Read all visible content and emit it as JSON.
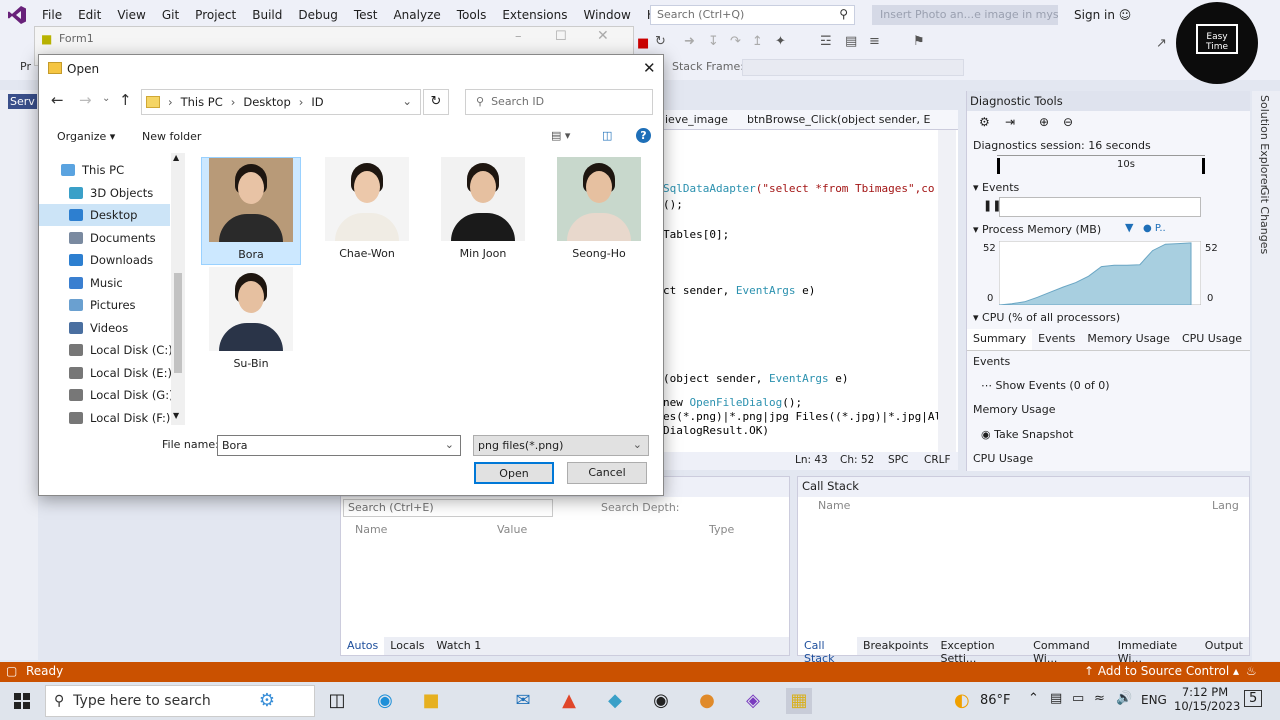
{
  "vs": {
    "menu": [
      "File",
      "Edit",
      "View",
      "Git",
      "Project",
      "Build",
      "Debug",
      "Test",
      "Analyze",
      "Tools",
      "Extensions",
      "Window",
      "Help"
    ],
    "search_placeholder": "Search (Ctrl+Q)",
    "solution_title": "Insert Photo an...e image in mysql",
    "signin": "Sign in",
    "stack_frame_label": "Stack Frame:",
    "left_tab_partial": "Serv",
    "pr_partial": "Pr",
    "editor": {
      "tab_left": "ieve_image",
      "tab_right": "btnBrowse_Click(object sender, E",
      "lines": [
        {
          "pre": "",
          "type": "SqlDataAdapter",
          "mid": "(\"select *from Tbimages\",co"
        },
        {
          "pre": "();",
          "type": "",
          "mid": ""
        },
        {
          "pre": "Tables[0];",
          "type": "",
          "mid": ""
        },
        {
          "pre": "ct sender, ",
          "type": "EventArgs",
          "mid": " e)"
        },
        {
          "pre": "(object sender, ",
          "type": "EventArgs",
          "mid": " e)"
        },
        {
          "pre": "new ",
          "type": "OpenFileDialog",
          "mid": "();"
        },
        {
          "pre": "es(*.png)|*.png|jpg Files((*.jpg)|*.jpg|Al",
          "type": "",
          "mid": ""
        },
        {
          "pre": "DialogResult.OK)",
          "type": "",
          "mid": ""
        }
      ],
      "status": {
        "ln": "Ln: 43",
        "ch": "Ch: 52",
        "spc": "SPC",
        "crlf": "CRLF"
      }
    },
    "diagnostic": {
      "title": "Diagnostic Tools",
      "session": "Diagnostics session: 16 seconds",
      "timeline_label": "10s",
      "events": "Events",
      "process_memory": "Process Memory (MB)",
      "mem_legend": "P..",
      "mem_max": "52",
      "mem_min": "0",
      "mem_max_right": "52",
      "mem_min_right": "0",
      "mem_series": [
        0,
        0.02,
        0.05,
        0.12,
        0.2,
        0.28,
        0.35,
        0.45,
        0.6,
        0.62,
        0.62,
        0.63,
        0.85,
        0.95,
        0.96,
        0.97
      ],
      "cpu": "CPU (% of all processors)",
      "tabs": [
        "Summary",
        "Events",
        "Memory Usage",
        "CPU Usage"
      ],
      "sec_events": "Events",
      "show_events": "Show Events (0 of 0)",
      "sec_memory": "Memory Usage",
      "take_snapshot": "Take Snapshot",
      "sec_cpu": "CPU Usage"
    },
    "side_tabs": [
      "Solution Explorer",
      "Git Changes"
    ],
    "autos": {
      "search_placeholder": "Search (Ctrl+E)",
      "depth_label": "Search Depth:",
      "cols": [
        "Name",
        "Value",
        "Type"
      ],
      "tabs": [
        "Autos",
        "Locals",
        "Watch 1"
      ]
    },
    "callstack": {
      "title": "Call Stack",
      "cols": [
        "Name",
        "Lang"
      ],
      "tabs": [
        "Call Stack",
        "Breakpoints",
        "Exception Setti...",
        "Command Wi...",
        "Immediate Wi...",
        "Output"
      ]
    },
    "status": {
      "ready": "Ready",
      "source_control": "Add to Source Control"
    }
  },
  "form1": {
    "title": "Form1"
  },
  "dialog": {
    "title": "Open",
    "breadcrumb": [
      "This PC",
      "Desktop",
      "ID"
    ],
    "search_placeholder": "Search ID",
    "organize": "Organize",
    "new_folder": "New folder",
    "nav": [
      "This PC",
      "3D Objects",
      "Desktop",
      "Documents",
      "Downloads",
      "Music",
      "Pictures",
      "Videos",
      "Local Disk (C:)",
      "Local Disk (E:)",
      "Local Disk (G:)",
      "Local Disk (F:)"
    ],
    "files": [
      "Bora",
      "Chae-Won",
      "Min Joon",
      "Seong-Ho",
      "Su-Bin"
    ],
    "file_name_label": "File name:",
    "file_name_value": "Bora",
    "filter": "png files(*.png)",
    "open": "Open",
    "cancel": "Cancel"
  },
  "logo": {
    "line1": "Easy Time"
  },
  "taskbar": {
    "search_placeholder": "Type here to search",
    "weather": "86°F",
    "lang": "ENG",
    "time": "7:12 PM",
    "date": "10/15/2023",
    "notif": "5"
  }
}
